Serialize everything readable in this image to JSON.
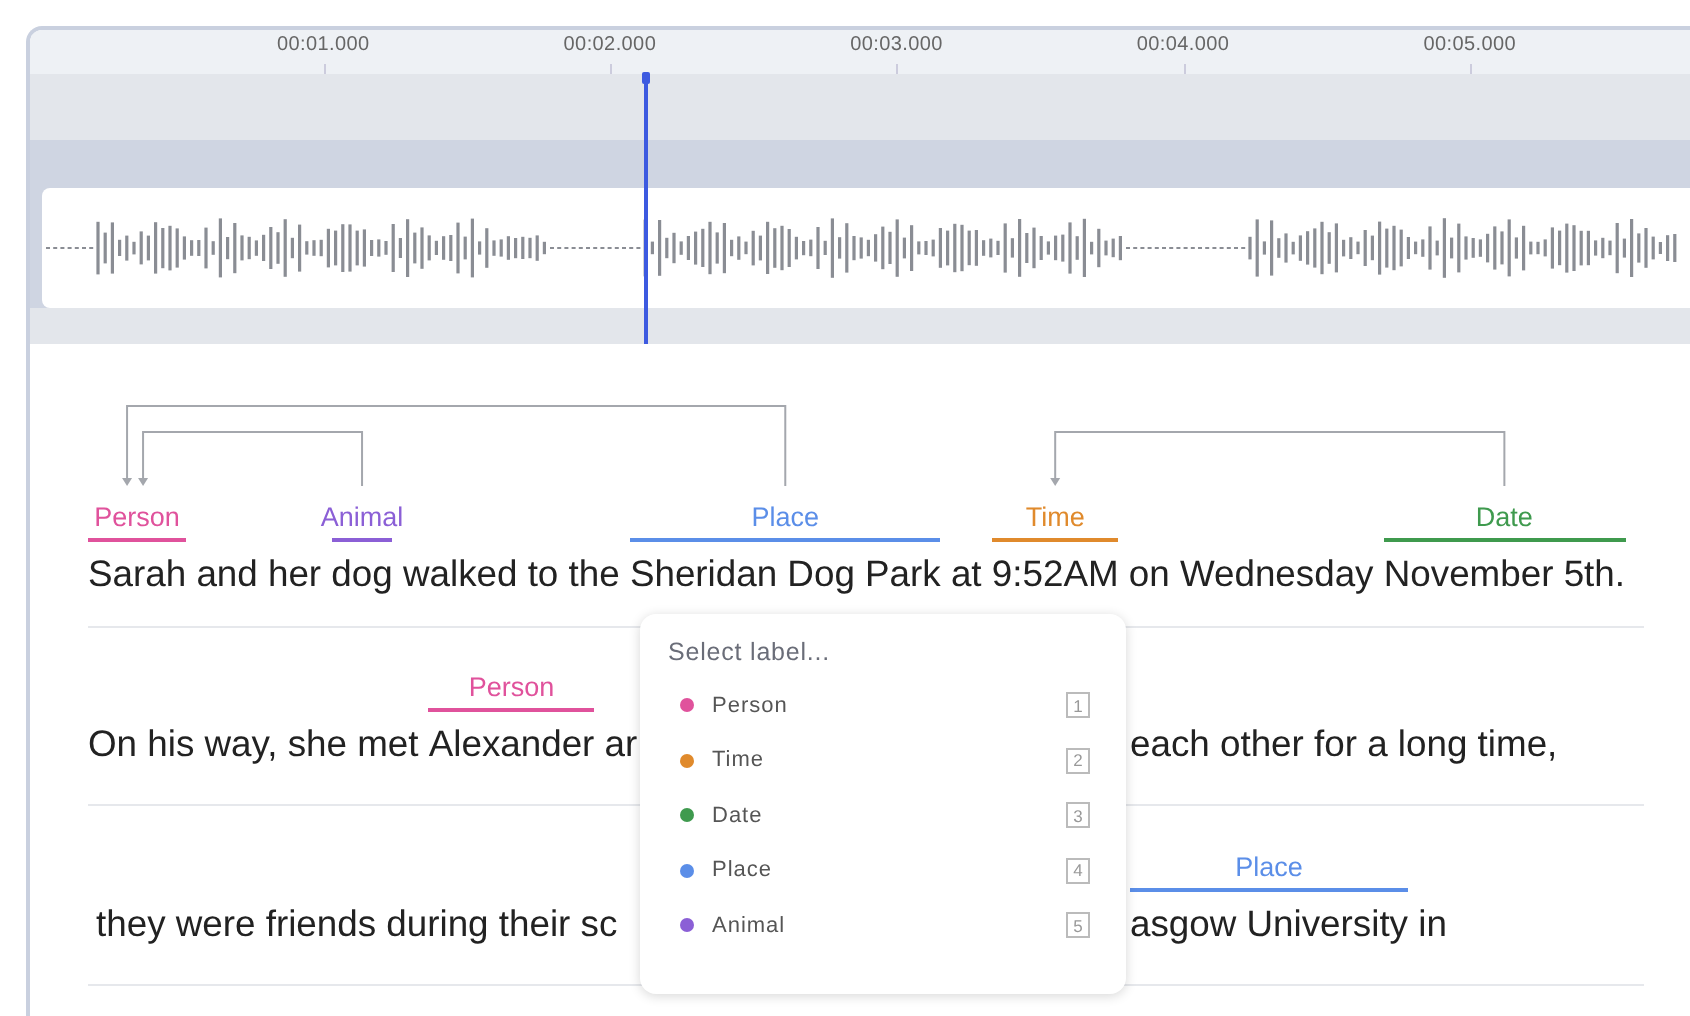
{
  "timeline": {
    "ticks": [
      "00:01.000",
      "00:02.000",
      "00:03.000",
      "00:04.000",
      "00:05.000"
    ]
  },
  "lines": [
    {
      "left": [
        {
          "kind": "entity",
          "text": "Sarah",
          "label": "Person",
          "color": "#e0529c"
        },
        {
          "kind": "text",
          "text": " and her "
        },
        {
          "kind": "entity",
          "text": "dog",
          "label": "Animal",
          "color": "#8b5fd6"
        },
        {
          "kind": "text",
          "text": " walked to the "
        },
        {
          "kind": "entity",
          "text": "Sheridan Dog Park",
          "label": "Place",
          "color": "#5b8ee8"
        },
        {
          "kind": "text",
          "text": " at "
        },
        {
          "kind": "entity",
          "text": "9:52AM",
          "label": "Time",
          "color": "#e08a2c"
        },
        {
          "kind": "text",
          "text": " on Wednesday "
        },
        {
          "kind": "entity",
          "text": "November 5th.",
          "label": "Date",
          "color": "#3f9a4e"
        }
      ]
    },
    {
      "left": [
        {
          "kind": "text",
          "text": "On his way, she met "
        },
        {
          "kind": "entity",
          "text": "Alexander",
          "label": "Person",
          "color": "#e0529c"
        },
        {
          "kind": "text",
          "text": " ar"
        }
      ],
      "right": [
        {
          "kind": "text",
          "text": "each other for a long time,"
        }
      ]
    },
    {
      "left": [
        {
          "kind": "text",
          "text": "they were friends during their sc"
        }
      ],
      "right": [
        {
          "kind": "entity",
          "text": "asgow University",
          "label": "Place",
          "color": "#5b8ee8"
        },
        {
          "kind": "text",
          "text": " in"
        }
      ]
    }
  ],
  "label_menu": {
    "title": "Select label...",
    "items": [
      {
        "name": "Person",
        "color": "#e0529c",
        "key": "1",
        "selected": false
      },
      {
        "name": "Time",
        "color": "#e08a2c",
        "key": "2",
        "selected": false
      },
      {
        "name": "Date",
        "color": "#3f9a4e",
        "key": "3",
        "selected": false
      },
      {
        "name": "Place",
        "color": "#5b8ee8",
        "key": "4",
        "selected": false
      },
      {
        "name": "Animal",
        "color": "#8b5fd6",
        "key": "5",
        "selected": false
      }
    ]
  }
}
